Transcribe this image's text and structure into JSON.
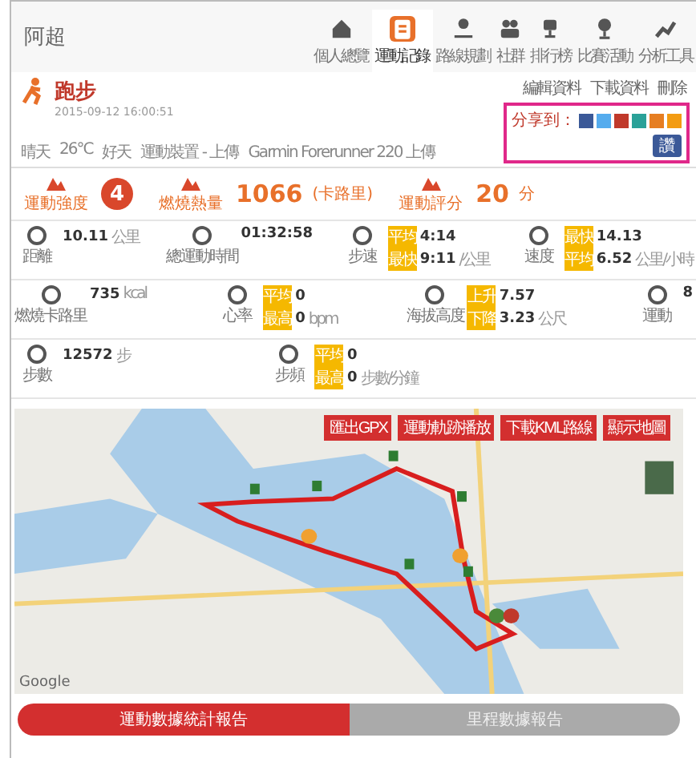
{
  "header": {
    "title": "阿超"
  },
  "nav": [
    {
      "label": "個人總覽",
      "selected": false
    },
    {
      "label": "運動記錄",
      "selected": true
    },
    {
      "label": "路線規劃",
      "selected": false
    },
    {
      "label": "社群",
      "selected": false
    },
    {
      "label": "排行榜",
      "selected": false
    },
    {
      "label": "比賽活動",
      "selected": false
    },
    {
      "label": "分析工具",
      "selected": false
    }
  ],
  "activity": {
    "type": "跑步",
    "date": "2015-09-12 16:00:51"
  },
  "actions": [
    "編輯資料",
    "下載資料",
    "刪除"
  ],
  "share": {
    "label": "分享到：",
    "like": "讚"
  },
  "conditions": [
    "晴天",
    "26°C",
    "好天",
    "運動裝置 - 上傳",
    "Garmin Forerunner 220 上傳"
  ],
  "summary": [
    {
      "label": "運動強度",
      "value": "4"
    },
    {
      "label": "燃燒熱量",
      "value": "1066",
      "unit": "(卡路里)"
    },
    {
      "label": "運動評分",
      "value": "20",
      "unit": "分"
    }
  ],
  "stats": [
    [
      {
        "label": "距離",
        "lines": [
          {
            "value": "10.11",
            "unit": "公里"
          }
        ]
      },
      {
        "label": "總運動時間",
        "lines": [
          {
            "value": "01:32:58"
          }
        ]
      },
      {
        "label": "步速",
        "lines": [
          {
            "tag": "平均",
            "value": "4:14"
          },
          {
            "tag": "最快",
            "value": "9:11",
            "unit": "/公里"
          }
        ]
      },
      {
        "label": "速度",
        "lines": [
          {
            "tag": "最快",
            "value": "14.13"
          },
          {
            "tag": "平均",
            "value": "6.52",
            "unit": "公里/小時"
          }
        ]
      }
    ],
    [
      {
        "label": "燃燒卡路里",
        "lines": [
          {
            "value": "735",
            "unit": "kcal"
          }
        ]
      },
      {
        "label": "心率",
        "lines": [
          {
            "tag": "平均",
            "value": "0"
          },
          {
            "tag": "最高",
            "value": "0",
            "unit": "bpm"
          }
        ]
      },
      {
        "label": "海拔高度",
        "lines": [
          {
            "tag": "上升",
            "value": "7.57"
          },
          {
            "tag": "下降",
            "value": "3.23",
            "unit": "公尺"
          }
        ]
      },
      {
        "label": "運動",
        "lines": [
          {
            "value": "8"
          }
        ]
      }
    ],
    [
      {
        "label": "步數",
        "lines": [
          {
            "value": "12572",
            "unit": "步"
          }
        ]
      },
      {
        "label": "步頻",
        "lines": [
          {
            "tag": "平均",
            "value": "0"
          },
          {
            "tag": "最高",
            "value": "0",
            "unit": "步數/分鐘"
          }
        ]
      }
    ]
  ],
  "map": {
    "buttons": [
      "匯出GPX",
      "運動軌跡播放",
      "下載KML路線",
      "顯示地圖"
    ],
    "attribution": "Google"
  },
  "report_tabs": [
    {
      "label": "運動數據統計報告",
      "selected": true
    },
    {
      "label": "里程數據報告",
      "selected": false
    }
  ]
}
